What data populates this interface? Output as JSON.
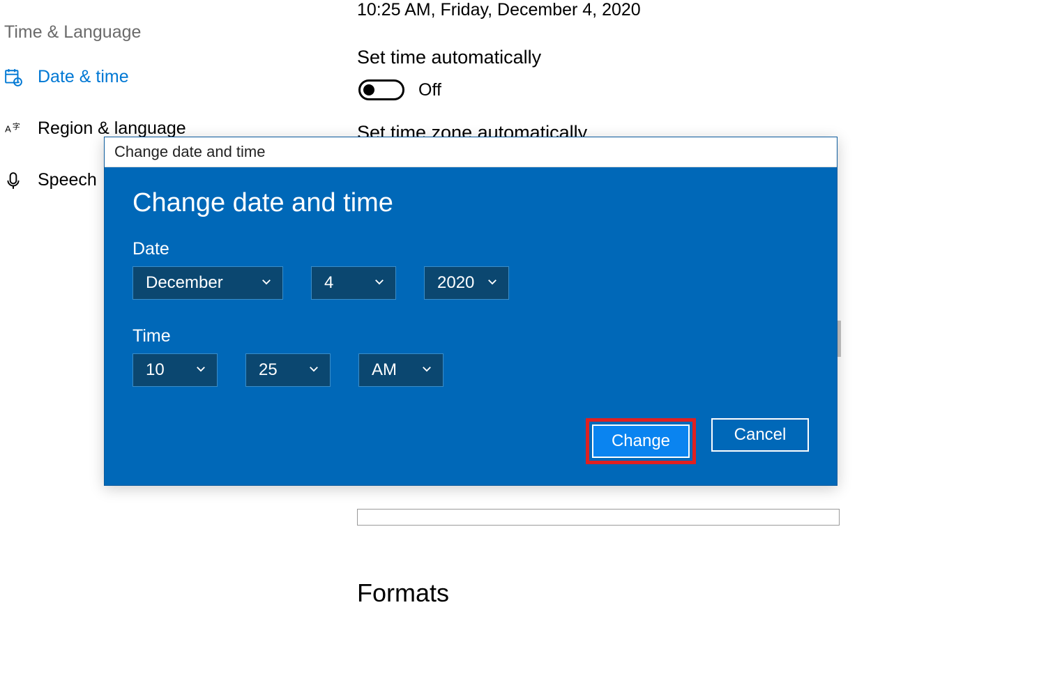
{
  "header": {
    "current_datetime": "10:25 AM, Friday, December 4, 2020",
    "section": "Time & Language"
  },
  "nav": {
    "date_time": "Date & time",
    "region_language": "Region & language",
    "speech": "Speech"
  },
  "settings": {
    "set_time_auto_label": "Set time automatically",
    "set_time_auto_state": "Off",
    "set_tz_auto_label": "Set time zone automatically",
    "formats_heading": "Formats"
  },
  "dialog": {
    "titlebar": "Change date and time",
    "heading": "Change date and time",
    "date_label": "Date",
    "time_label": "Time",
    "month": "December",
    "day": "4",
    "year": "2020",
    "hour": "10",
    "minute": "25",
    "ampm": "AM",
    "change_btn": "Change",
    "cancel_btn": "Cancel"
  }
}
